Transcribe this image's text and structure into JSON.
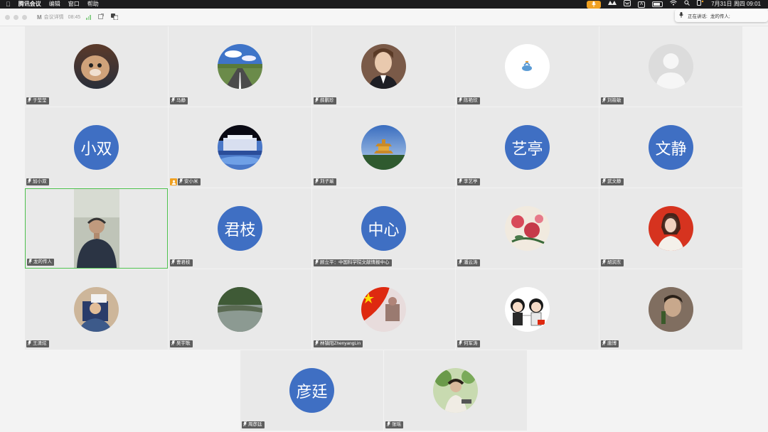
{
  "menubar": {
    "apple": "",
    "app_name": "腾讯会议",
    "menus": [
      "编辑",
      "窗口",
      "帮助"
    ],
    "tray_box": "A",
    "datetime": "7月31日 周四 09:01"
  },
  "titlebar": {
    "logo": "M",
    "meeting_title": "会议详情",
    "timer": "08:45"
  },
  "toast": {
    "label": "正在讲话:",
    "speaker": "龙的传人;"
  },
  "participants": [
    {
      "name": "于莹莹",
      "avatar": "photo-cat"
    },
    {
      "name": "马静",
      "avatar": "photo-road"
    },
    {
      "name": "薛鹏珍",
      "avatar": "photo-woman"
    },
    {
      "name": "陈艳欣",
      "avatar": "photo-white"
    },
    {
      "name": "刘筱敏",
      "avatar": "default-person"
    },
    {
      "name": "加小双",
      "avatar_text": "小双"
    },
    {
      "name": "安小米",
      "avatar": "photo-building",
      "host": true
    },
    {
      "name": "刘子瑜",
      "avatar": "photo-pavilion"
    },
    {
      "name": "李艺亭",
      "avatar_text": "艺亭"
    },
    {
      "name": "武文静",
      "avatar_text": "文静"
    },
    {
      "name": "龙的传人",
      "avatar": "video",
      "active": true
    },
    {
      "name": "曹君枝",
      "avatar_text": "君枝"
    },
    {
      "name": "顾立平：中国科学院文献情报中心",
      "avatar_text": "中心"
    },
    {
      "name": "潘云涛",
      "avatar": "photo-flowers"
    },
    {
      "name": "胡润东",
      "avatar": "photo-girl"
    },
    {
      "name": "王清炫",
      "avatar": "photo-selfie"
    },
    {
      "name": "吴宇歌",
      "avatar": "photo-lake"
    },
    {
      "name": "林镇阳ZhenyangLin",
      "avatar": "photo-flag"
    },
    {
      "name": "何军涛",
      "avatar": "photo-cartoon"
    },
    {
      "name": "唐博",
      "avatar": "photo-dark"
    },
    {
      "name": "周彦廷",
      "avatar_text": "彦廷"
    },
    {
      "name": "张瑶",
      "avatar": "photo-garden"
    }
  ],
  "colors": {
    "text_avatar": "#3f6fc3",
    "active_border": "#4cbf4c",
    "mic_active": "#f0a020"
  }
}
